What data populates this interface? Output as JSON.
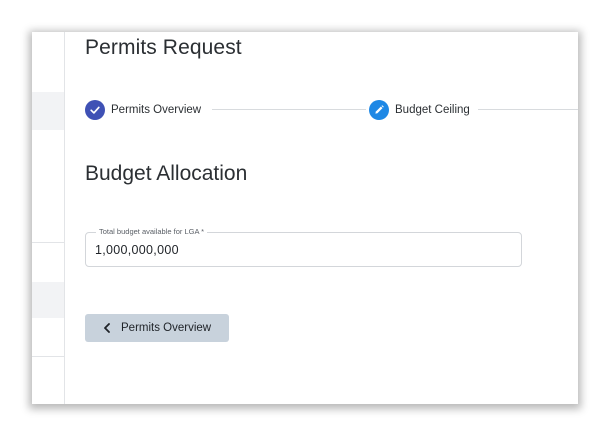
{
  "page": {
    "title": "Permits Request"
  },
  "stepper": {
    "steps": [
      {
        "label": "Permits Overview",
        "state": "completed",
        "icon": "check-icon",
        "color": "#3f51b5"
      },
      {
        "label": "Budget Ceiling",
        "state": "active",
        "icon": "pencil-icon",
        "color": "#1e88e5"
      }
    ]
  },
  "section": {
    "title": "Budget Allocation"
  },
  "budget_field": {
    "label": "Total budget available for LGA *",
    "value": "1,000,000,000"
  },
  "actions": {
    "back_label": "Permits Overview",
    "back_icon": "chevron-left-icon",
    "back_color": "#c8d2dc"
  }
}
